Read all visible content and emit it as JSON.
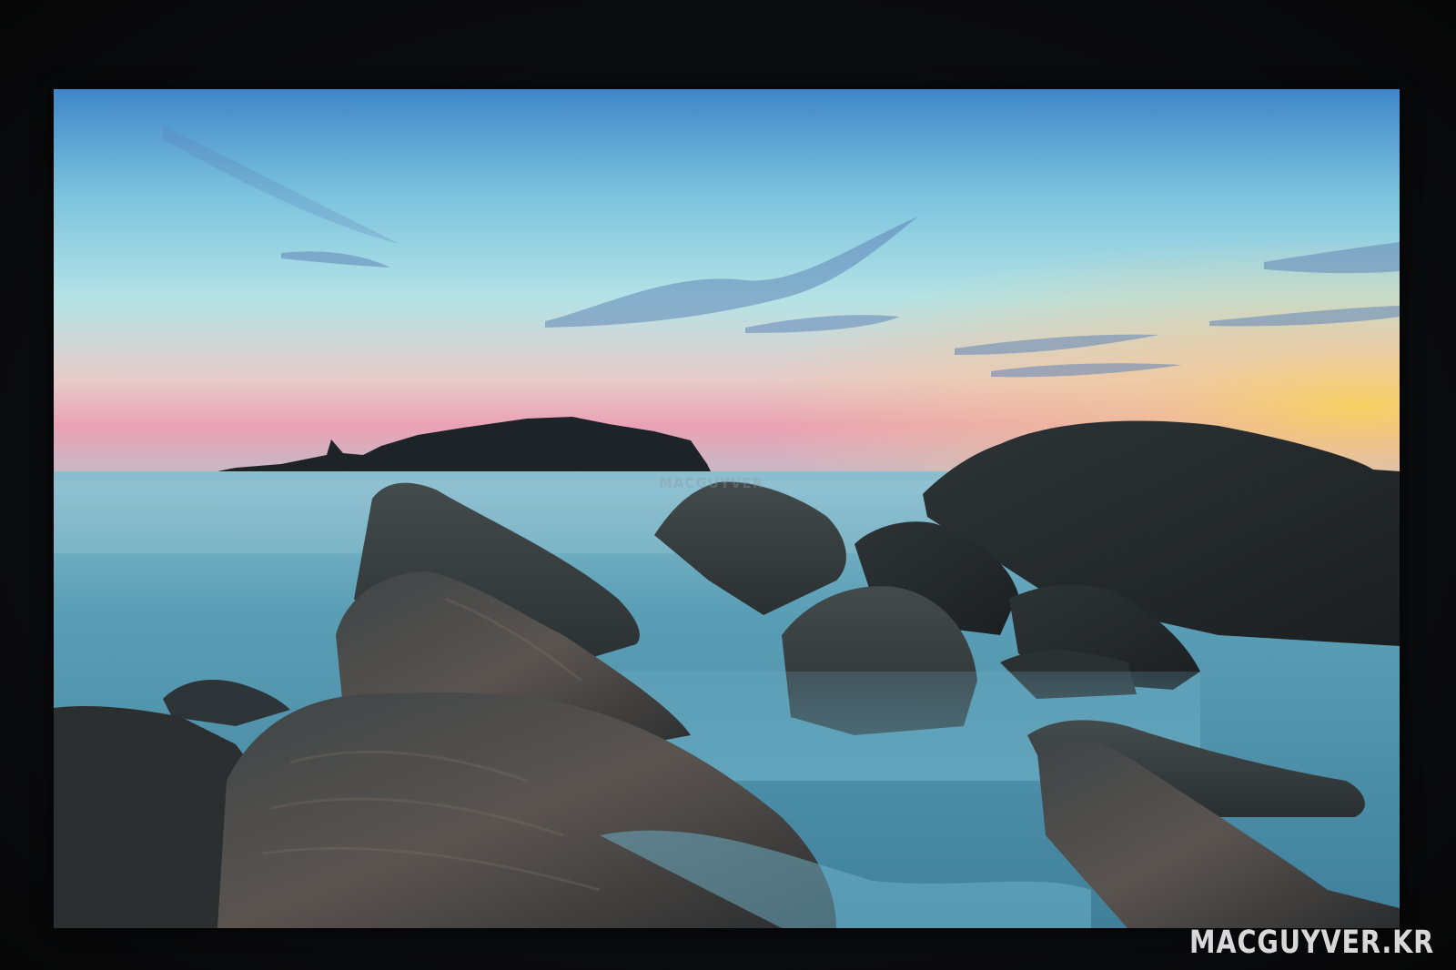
{
  "photo": {
    "subject": "seascape-rocks-sunset",
    "colors": {
      "sky_top": "#4f93d1",
      "sky_mid": "#8fd4e4",
      "horizon_pink": "#e8a6bd",
      "horizon_yellow": "#f3d77a",
      "sea": "#4d8fa8",
      "rock": "#2b2e30",
      "bezel": "#0a0b0d"
    }
  },
  "watermark": {
    "corner_text": "MACGUYVER.KR",
    "center_text": "MACGUYVER"
  }
}
